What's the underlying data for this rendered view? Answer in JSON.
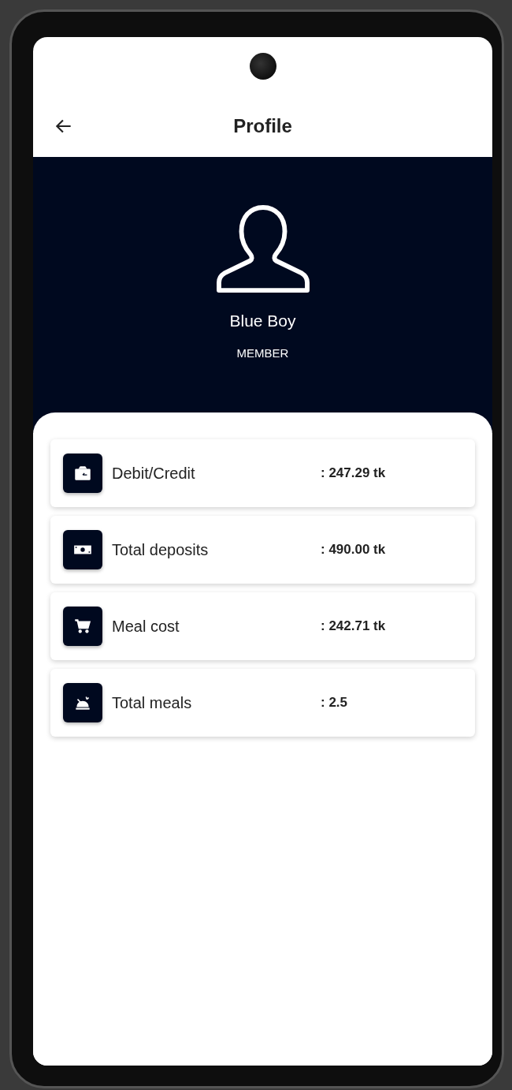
{
  "header": {
    "title": "Profile"
  },
  "profile": {
    "name": "Blue Boy",
    "role": "MEMBER"
  },
  "stats": [
    {
      "kind": "wallet",
      "label": "Debit/Credit",
      "value": ": 247.29 tk"
    },
    {
      "kind": "cash",
      "label": "Total deposits",
      "value": ": 490.00 tk"
    },
    {
      "kind": "cart",
      "label": "Meal cost",
      "value": ": 242.71 tk"
    },
    {
      "kind": "meal",
      "label": "Total meals",
      "value": ": 2.5"
    }
  ]
}
